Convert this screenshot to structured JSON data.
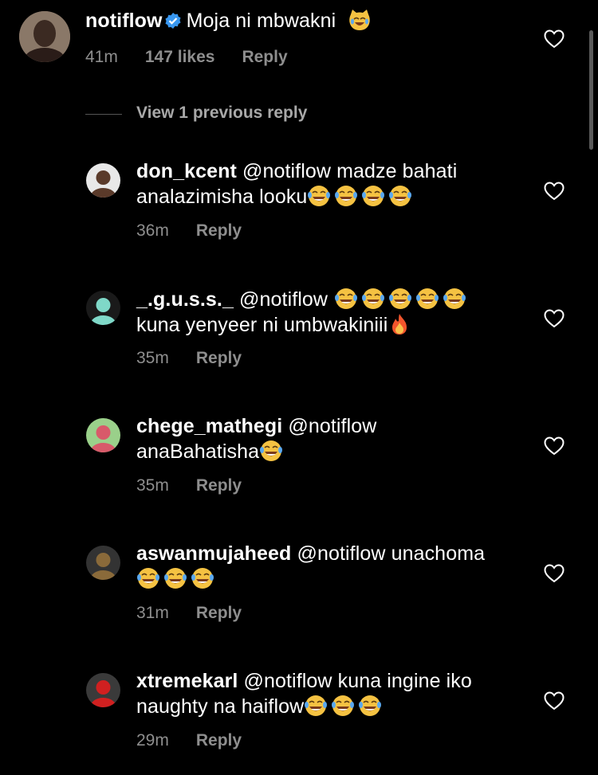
{
  "top_comment": {
    "username": "notiflow",
    "text": "Moja ni mbwakni",
    "emoji": "cat-tears-of-joy",
    "time": "41m",
    "likes": "147 likes",
    "reply": "Reply"
  },
  "view_previous": "View 1 previous reply",
  "replies": [
    {
      "username": "don_kcent",
      "text_line1": "@notiflow madze bahati",
      "text_line2": "analazimisha looku",
      "emoji_count": 4,
      "time": "36m",
      "reply": "Reply"
    },
    {
      "username": "_.g.u.s.s._",
      "text_line1": "@notiflow",
      "text_line2": "kuna yenyeer ni umbwakiniii",
      "emoji_count": 5,
      "time": "35m",
      "reply": "Reply"
    },
    {
      "username": "chege_mathegi",
      "text_line1": "@notiflow",
      "text_line2": "anaBahatisha",
      "emoji_count": 1,
      "time": "35m",
      "reply": "Reply"
    },
    {
      "username": "aswanmujaheed",
      "text_line1": "@notiflow unachoma",
      "text_line2": "",
      "emoji_count": 3,
      "time": "31m",
      "reply": "Reply"
    },
    {
      "username": "xtremekarl",
      "text_line1": "@notiflow kuna ingine iko",
      "text_line2": "naughty na haiflow",
      "emoji_count": 3,
      "time": "29m",
      "reply": "Reply"
    }
  ],
  "colors": {
    "background": "#000000",
    "meta": "#8e8e8e",
    "verified": "#3897f0"
  }
}
